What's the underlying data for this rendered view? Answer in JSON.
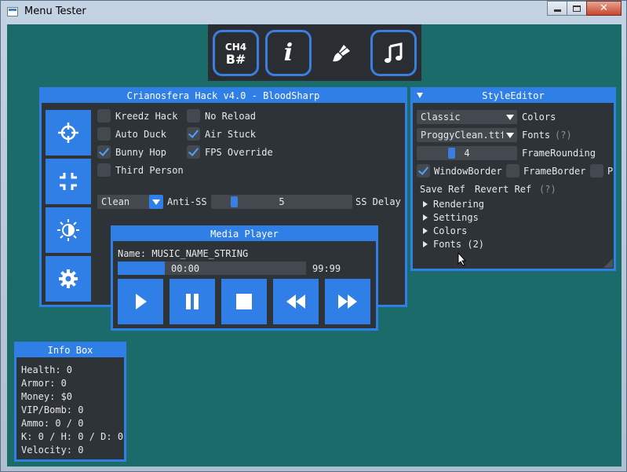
{
  "window": {
    "title": "Menu Tester"
  },
  "toolbar": {
    "channel_top": "CH4",
    "channel_bottom": "B#"
  },
  "hack": {
    "title": "Crianosfera Hack v4.0 - BloodSharp",
    "options": [
      {
        "label": "Kreedz Hack",
        "checked": false
      },
      {
        "label": "No Reload",
        "checked": false
      },
      {
        "label": "Auto Duck",
        "checked": false
      },
      {
        "label": "Air Stuck",
        "checked": true
      },
      {
        "label": "Bunny Hop",
        "checked": true
      },
      {
        "label": "FPS Override",
        "checked": true
      },
      {
        "label": "Third Person",
        "checked": false
      }
    ],
    "anti_ss_value": "Clean",
    "anti_ss_label": "Anti-SS",
    "ss_delay_value": "5",
    "ss_delay_label": "SS Delay"
  },
  "style_editor": {
    "title": "StyleEditor",
    "colors_combo": "Classic",
    "colors_label": "Colors",
    "fonts_combo": "ProggyClean.ttf,",
    "fonts_label": "Fonts",
    "fonts_help": "(?)",
    "frame_rounding_value": "4",
    "frame_rounding_label": "FrameRounding",
    "window_border_label": "WindowBorder",
    "frame_border_label": "FrameBorder",
    "popup_border_label": "P",
    "save_ref": "Save Ref",
    "revert_ref": "Revert Ref",
    "ref_help": "(?)",
    "tree": [
      "Rendering",
      "Settings",
      "Colors",
      "Fonts (2)"
    ]
  },
  "media": {
    "title": "Media Player",
    "name_label": "Name: MUSIC_NAME_STRING",
    "time_current": "00:00",
    "time_total": "99:99",
    "progress": 0.25
  },
  "info": {
    "title": "Info Box",
    "lines": [
      "Health: 0",
      "Armor: 0",
      "Money: $0",
      "VIP/Bomb: 0",
      "Ammo: 0 / 0",
      "K: 0 / H: 0 / D: 0",
      "Velocity: 0"
    ]
  },
  "colors": {
    "accent": "#2f7fe6",
    "panel": "#2e3338",
    "background": "#1c6b6b"
  }
}
